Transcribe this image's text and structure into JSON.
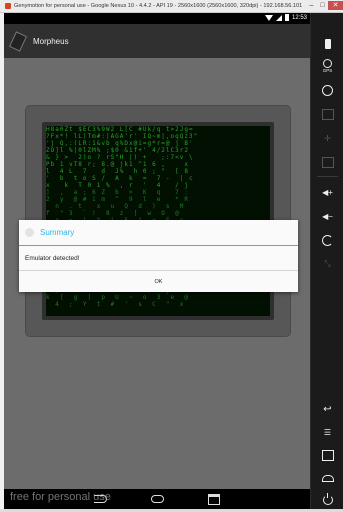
{
  "window": {
    "title": "Genymotion for personal use - Google Nexus 10 - 4.4.2 - API 19 - 2560x1600 (2560x1600, 320dpi) - 192.168.56.101"
  },
  "statusbar": {
    "time": "12:53"
  },
  "actionbar": {
    "app_title": "Morpheus"
  },
  "dialog": {
    "title": "Summary",
    "message": "Emulator detected!",
    "ok_label": "OK"
  },
  "watermark": "free for personal use",
  "sidebar": {
    "gps_label": "GPS"
  },
  "matrix": {
    "rows": [
      "H8a0Zt $EC3%9W2 L[C #Uk/q t>2Jg=",
      "?Fx*! lL)Tm#:|AGA'r' IQ~m|,oqQz3\"",
      "'j Q,:(LR:1&vb q%Dx@i=g*r=@ j B'",
      "ZO]l %|0lZM% ;$0 &1f+' 4/2lC3r2",
      "& } >  2)o ? rS\"H |) +   ;:7<v \\",
      "Pb 1 vT8 r; 8.@ jk1 ^1 6 ,    x ",
      "l  4 L  7   d  J%  h 0 ; \"  [ 8",
      "'  b  t o S /  A  k  =  7 -  | c",
      "x   k  T 0 1 %  , r  '  4   / j",
      "]  ,  a ; 6 Z  b  >  K  q   7 :",
      "2  y  @ # i m  ^  9  l  e   * R",
      "  n  . t   x  u  Q  d  )  s  M",
      "f  \" 3  ` !  8  z  [  w  O  @",
      "  o  =  |  X  i  5  j  <  E  c",
      "c  1  &  H  ~  4  v  2  *  t  o",
      "  T  q  (  y  b  G  m  %  &  Z",
      "w  \\  J  z  ;  >  p  8  n  ]  1",
      "  ^  s  Y  i  7  K  \"  e  ,  d",
      "Q  -  @  l  6  '  r  u  #  f  M",
      "  k  o  =  x  F  a  J  c  /  y",
      "L  9  (  v  E  b  t  .  ?  !  3",
      "  g  W  |  P  %  <  $  -  d  :",
      "r  &  n  1  :  M  h  )  j  ^  H",
      "  ,  6  w  S  *  f  z  b  y  7",
      "k  [  g  ]  p  U  ~  o  3  e  @",
      "  4  ;  Y  t  #  '  s  C  \"  x"
    ]
  },
  "colors": {
    "accent": "#33b5e5",
    "matrix_green": "#2aa02a",
    "screen_bg": "#6c6c6c"
  }
}
